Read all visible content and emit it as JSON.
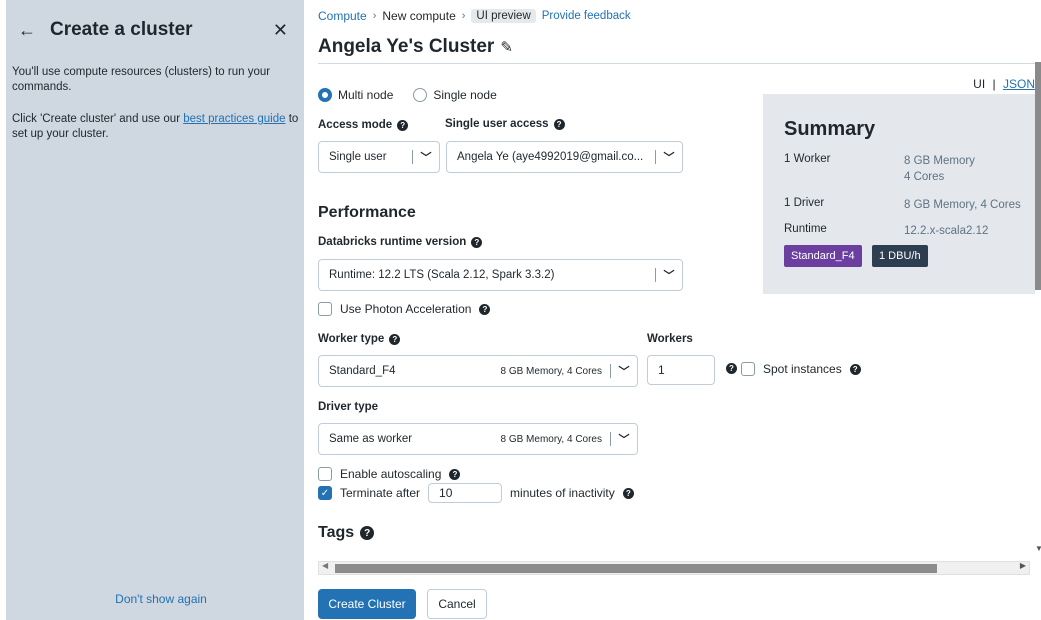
{
  "panel": {
    "title": "Create a cluster",
    "intro": "You'll use compute resources (clusters) to run your commands.",
    "guide_prefix": "Click 'Create cluster' and use our ",
    "guide_link": "best practices guide",
    "guide_suffix": " to set up your cluster.",
    "dont_show": "Don't show again"
  },
  "breadcrumb": {
    "items": [
      "Compute",
      "New compute"
    ],
    "preview_badge": "UI preview",
    "feedback": "Provide feedback"
  },
  "page": {
    "title": "Angela Ye's Cluster"
  },
  "view_toggle": {
    "ui": "UI",
    "separator": "|",
    "json": "JSON"
  },
  "node_mode": {
    "options": [
      "Multi node",
      "Single node"
    ],
    "selected": "Multi node"
  },
  "access": {
    "mode_label": "Access mode",
    "mode_value": "Single user",
    "user_label": "Single user access",
    "user_value": "Angela Ye (aye4992019@gmail.co..."
  },
  "performance": {
    "heading": "Performance",
    "runtime_label": "Databricks runtime version",
    "runtime_value": "Runtime: 12.2 LTS (Scala 2.12, Spark 3.3.2)",
    "photon_label": "Use Photon Acceleration",
    "photon_checked": false
  },
  "worker": {
    "type_label": "Worker type",
    "type_value": "Standard_F4",
    "type_hint": "8 GB Memory, 4 Cores",
    "workers_label": "Workers",
    "workers_value": "1",
    "spot_label": "Spot instances",
    "spot_checked": false
  },
  "driver": {
    "type_label": "Driver type",
    "type_value": "Same as worker",
    "type_hint": "8 GB Memory, 4 Cores"
  },
  "autoscaling": {
    "label": "Enable autoscaling",
    "checked": false
  },
  "terminate": {
    "label": "Terminate after",
    "minutes": "10",
    "suffix": "minutes of inactivity",
    "checked": true
  },
  "tags": {
    "heading": "Tags"
  },
  "summary": {
    "title": "Summary",
    "worker_key": "1 Worker",
    "worker_mem": "8 GB Memory",
    "worker_cores": "4 Cores",
    "driver_key": "1 Driver",
    "driver_val": "8 GB Memory, 4 Cores",
    "runtime_key": "Runtime",
    "runtime_val": "12.2.x-scala2.12",
    "badge_type": "Standard_F4",
    "badge_dbu": "1 DBU/h"
  },
  "actions": {
    "create": "Create Cluster",
    "cancel": "Cancel"
  },
  "colors": {
    "accent": "#2272b4",
    "panel_bg": "#cfd7e0",
    "summary_bg": "#e4e8ec",
    "badge_purple": "#6b3fa0",
    "badge_dark": "#2c3e50"
  }
}
